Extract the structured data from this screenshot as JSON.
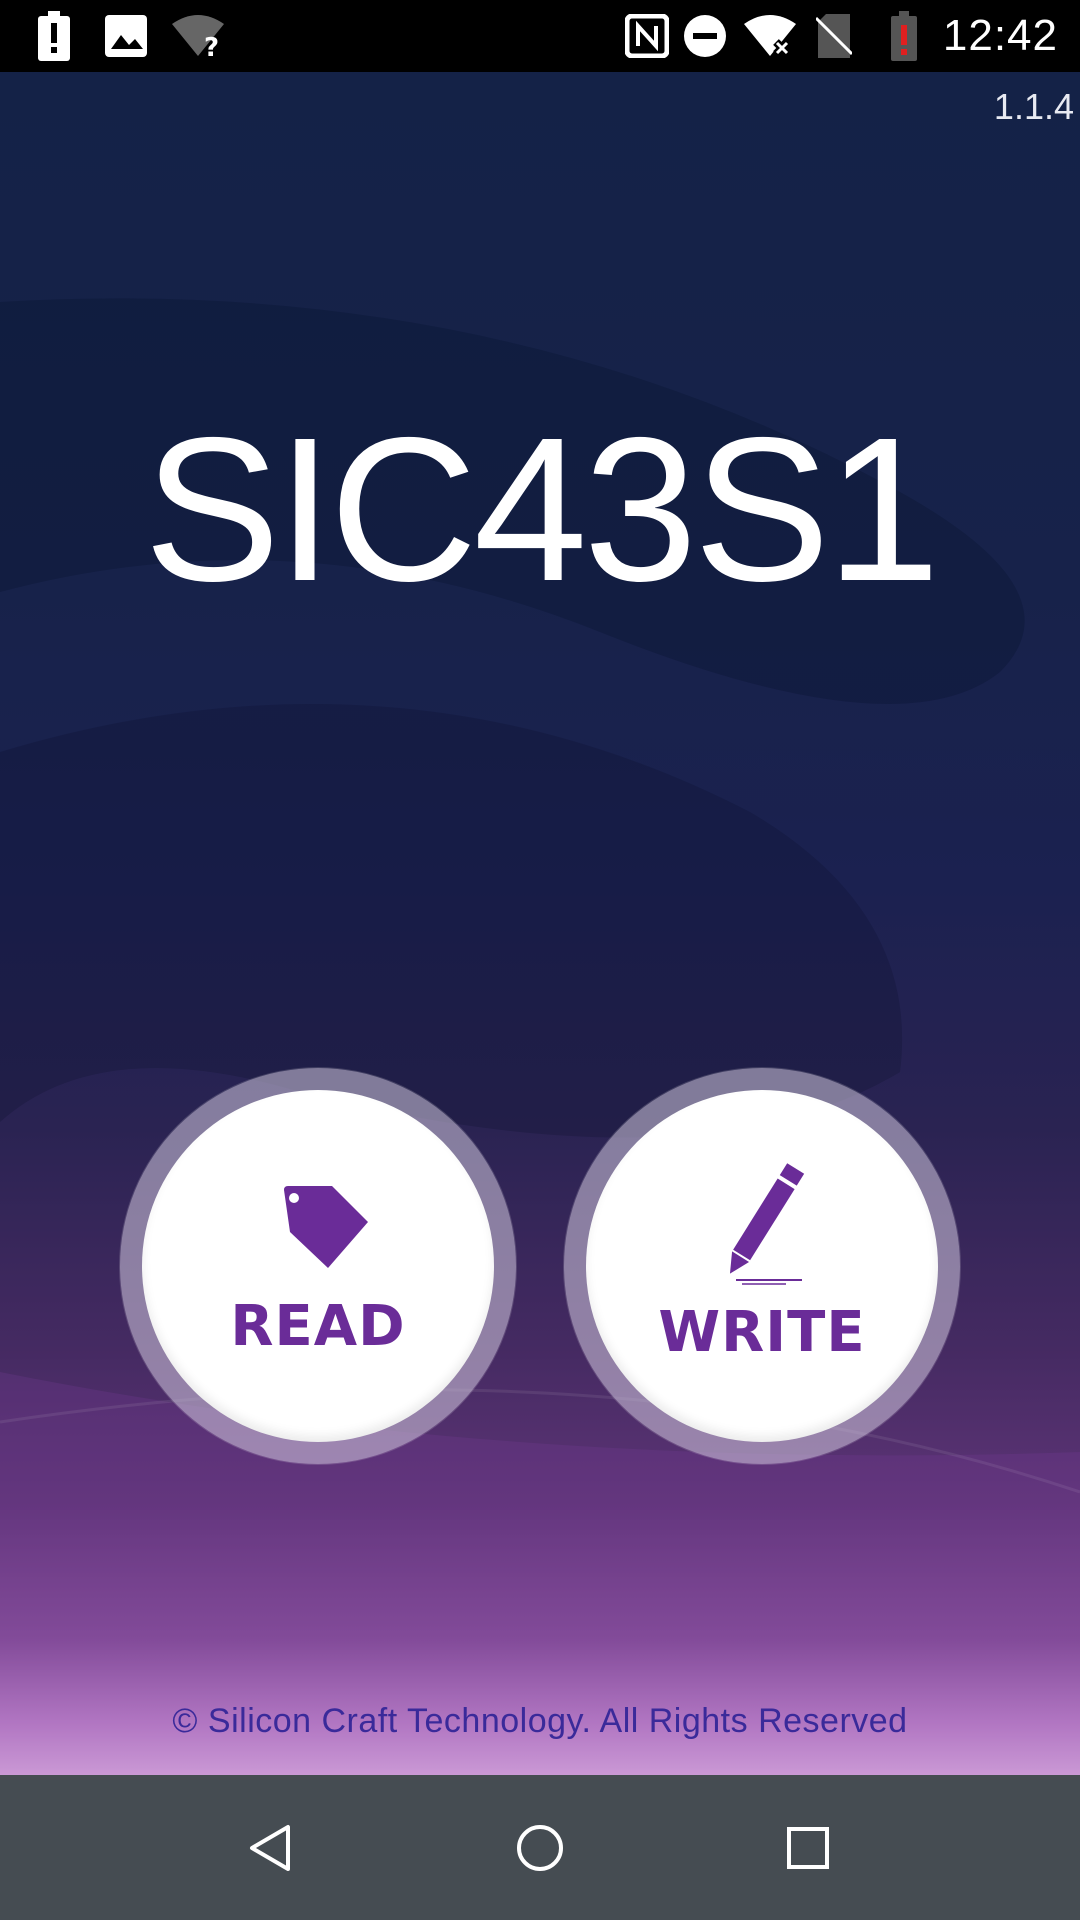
{
  "status_bar": {
    "time": "12:42",
    "icons": [
      "battery-alert-icon",
      "image-icon",
      "wifi-question-icon",
      "nfc-icon",
      "do-not-disturb-icon",
      "wifi-off-icon",
      "no-sim-icon",
      "battery-low-icon"
    ]
  },
  "app": {
    "version": "1.1.4",
    "title": "SIC43S1",
    "read_label": "READ",
    "write_label": "WRITE",
    "copyright": "©  Silicon Craft Technology. All Rights Reserved"
  },
  "nav_bar": {
    "icons": [
      "back-icon",
      "home-icon",
      "recents-icon"
    ]
  },
  "colors": {
    "accent": "#6a2c98",
    "background_top": "#142247",
    "background_bottom": "#e6b8ea",
    "nav_bar": "#454c52"
  }
}
